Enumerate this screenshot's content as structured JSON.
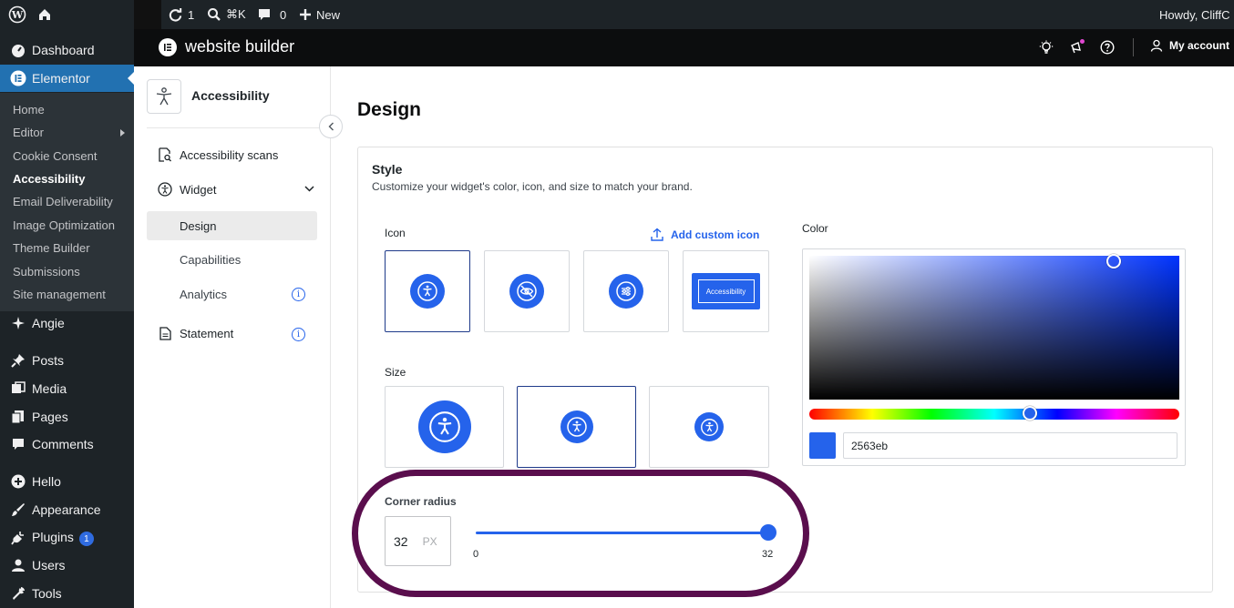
{
  "adminbar": {
    "updates_count": "1",
    "search_shortcut": "⌘K",
    "comments_count": "0",
    "new_label": "New",
    "howdy": "Howdy, CliffC"
  },
  "menu": {
    "dashboard": "Dashboard",
    "elementor": "Elementor",
    "submenu": [
      "Home",
      "Editor",
      "Cookie Consent",
      "Accessibility",
      "Email Deliverability",
      "Image Optimization",
      "Theme Builder",
      "Submissions",
      "Site management"
    ],
    "angie": "Angie",
    "posts": "Posts",
    "media": "Media",
    "pages": "Pages",
    "comments": "Comments",
    "hello": "Hello",
    "appearance": "Appearance",
    "plugins": "Plugins",
    "plugins_badge": "1",
    "users": "Users",
    "tools": "Tools"
  },
  "plugin_header": {
    "title": "website builder",
    "account": "My account"
  },
  "side_panel": {
    "title": "Accessibility",
    "items": {
      "scans": "Accessibility scans",
      "widget": "Widget",
      "design": "Design",
      "capabilities": "Capabilities",
      "analytics": "Analytics",
      "statement": "Statement"
    }
  },
  "main": {
    "page_title": "Design",
    "style_title": "Style",
    "style_desc": "Customize your widget's color, icon, and size to match your brand.",
    "icon_label": "Icon",
    "add_custom_icon": "Add custom icon",
    "icon_text_option": "Accessibility",
    "size_label": "Size",
    "color_label": "Color",
    "hex_value": "2563eb",
    "corner_label": "Corner radius",
    "corner_value": "32",
    "corner_unit": "PX",
    "slider_min": "0",
    "slider_max": "32",
    "slider_fraction": 1.0
  },
  "colors": {
    "accent": "#2563eb",
    "admin_bg": "#1d2327",
    "active_menu": "#2271b1",
    "highlight": "#5a0e4d"
  }
}
